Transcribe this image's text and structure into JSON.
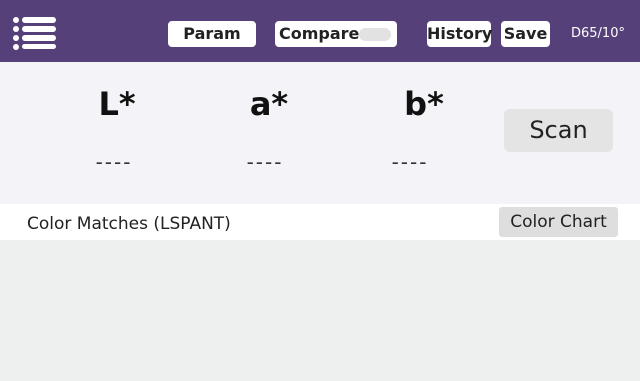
{
  "header": {
    "menu_icon": "hamburger-menu-icon",
    "param_label": "Param",
    "compare_label": "Compare",
    "compare_toggle_on": false,
    "history_label": "History",
    "save_label": "Save",
    "illuminant": "D65/10°"
  },
  "readout": {
    "l_label": "L*",
    "a_label": "a*",
    "b_label": "b*",
    "l_value": "----",
    "a_value": "----",
    "b_value": "----",
    "scan_label": "Scan"
  },
  "matches": {
    "title": "Color Matches (LSPANT)",
    "chart_label": "Color Chart"
  },
  "colors": {
    "header_bg": "#56407a",
    "readout_bg": "#f3f3f8",
    "results_bg": "#eef0ef"
  }
}
